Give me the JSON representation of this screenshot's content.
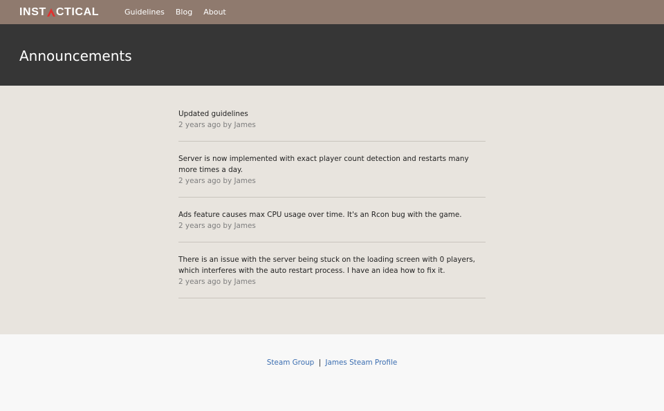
{
  "brand": {
    "logo_left": "INST",
    "logo_right": "CTICAL",
    "accent_color": "#e0312f"
  },
  "nav": {
    "items": [
      {
        "label": "Guidelines"
      },
      {
        "label": "Blog"
      },
      {
        "label": "About"
      }
    ]
  },
  "hero": {
    "title": "Announcements"
  },
  "posts": [
    {
      "title": "Updated guidelines",
      "meta": "2 years ago by James"
    },
    {
      "title": "Server is now implemented with exact player count detection and restarts many more times a day.",
      "meta": "2 years ago by James"
    },
    {
      "title": "Ads feature causes max CPU usage over time. It's an Rcon bug with the game.",
      "meta": "2 years ago by James"
    },
    {
      "title": "There is an issue with the server being stuck on the loading screen with 0 players, which interferes with the auto restart process. I have an idea how to fix it.",
      "meta": "2 years ago by James"
    }
  ],
  "footer": {
    "link1": "Steam Group",
    "separator": "|",
    "link2": "James Steam Profile"
  }
}
